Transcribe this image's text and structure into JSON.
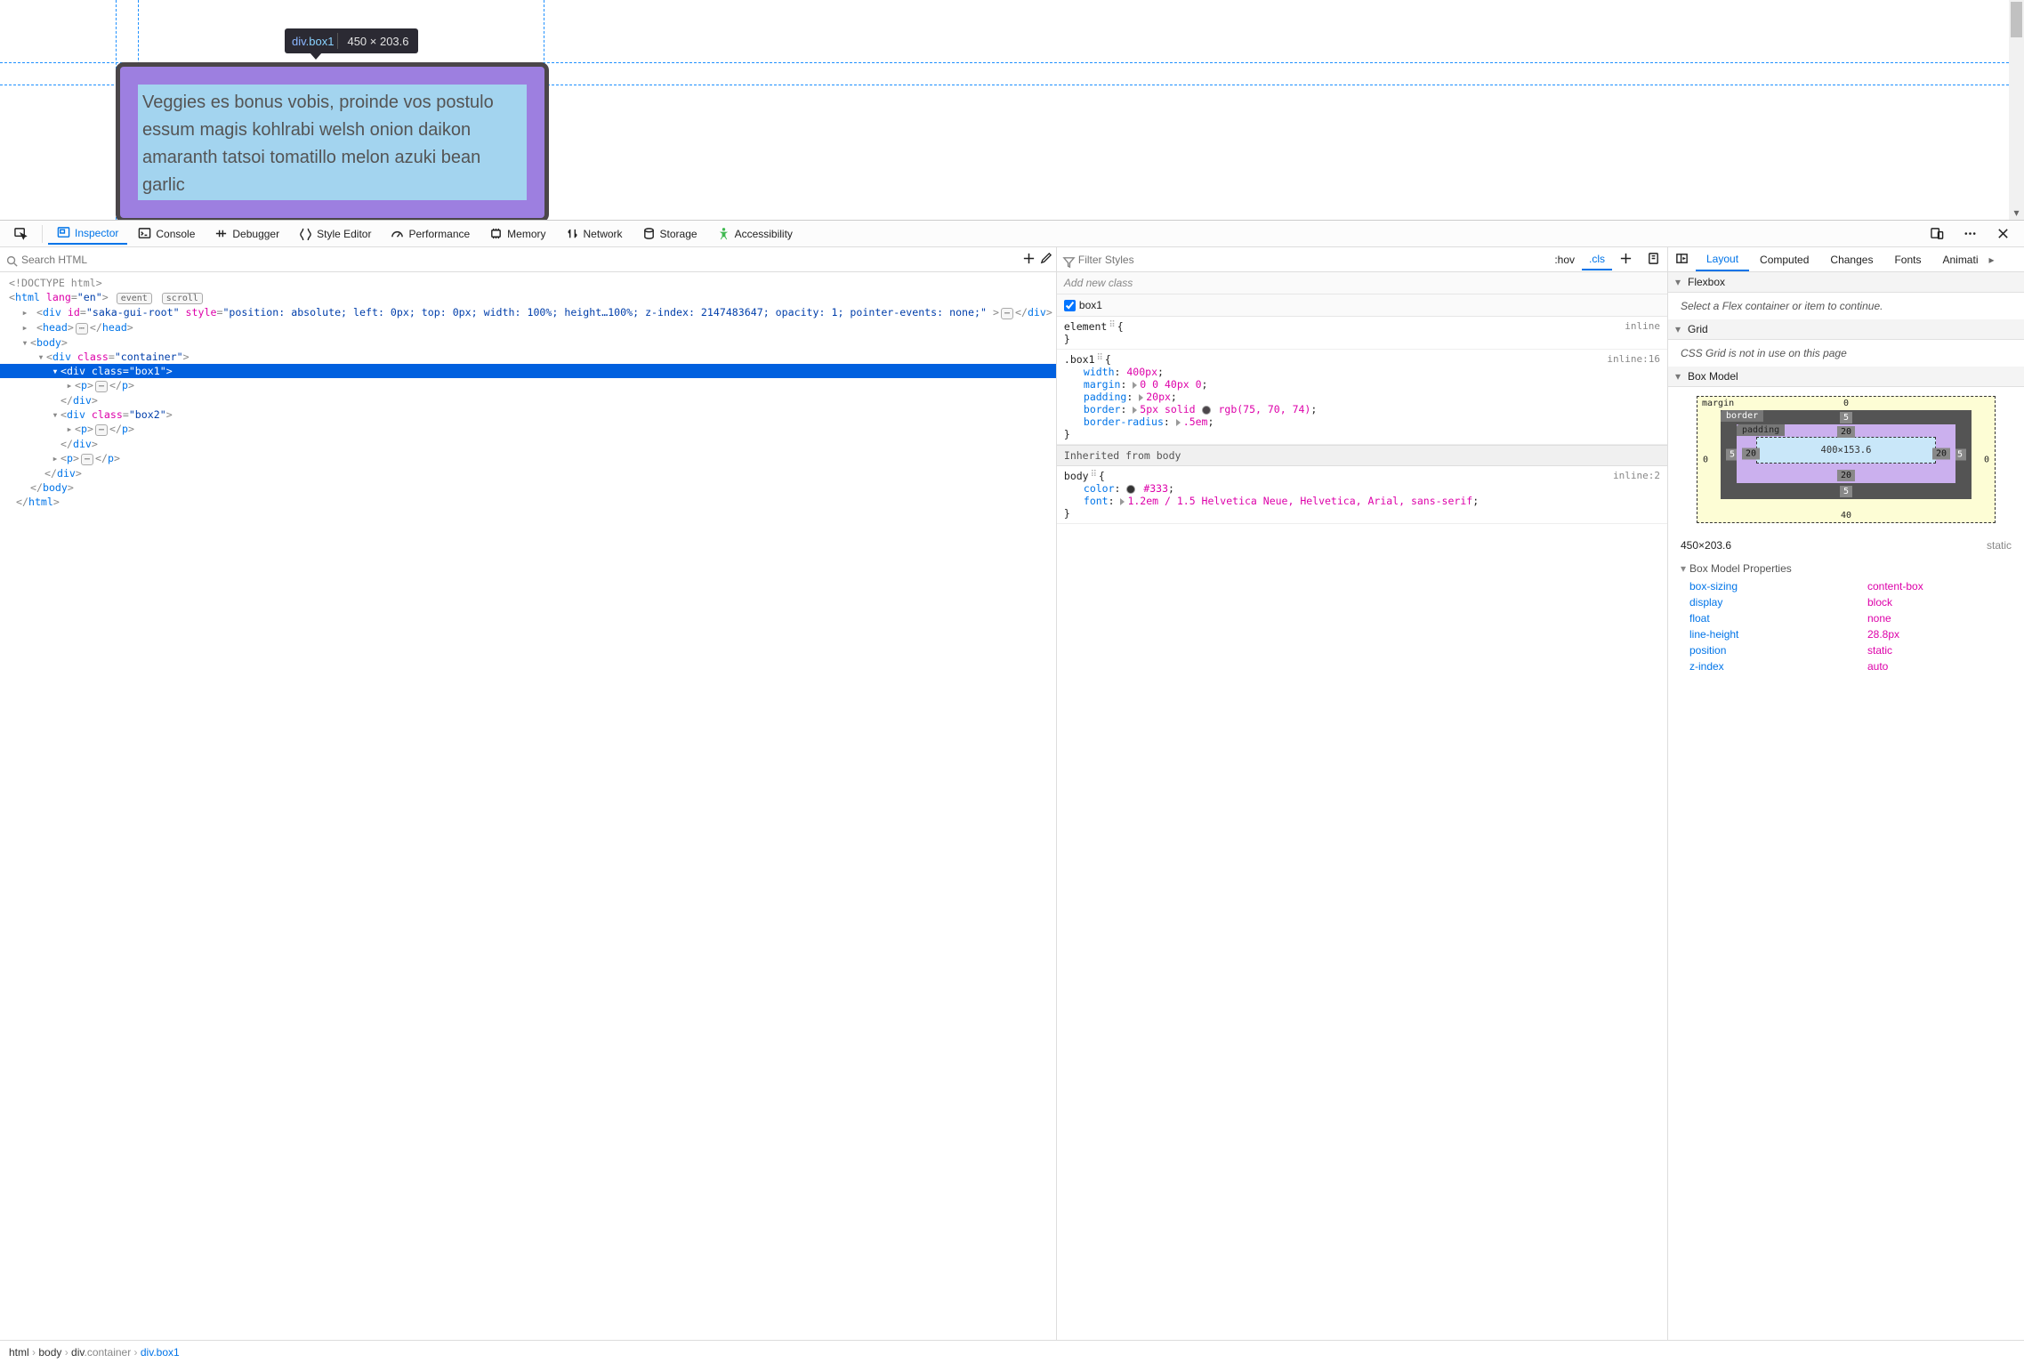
{
  "tooltip": {
    "tag": "div",
    "cls": ".box1",
    "dims": "450 × 203.6"
  },
  "viewport_text": "Veggies es bonus vobis, proinde vos postulo essum magis kohlrabi welsh onion daikon amaranth tatsoi tomatillo melon azuki bean garlic",
  "toolbar": {
    "inspector": "Inspector",
    "console": "Console",
    "debugger": "Debugger",
    "styleeditor": "Style Editor",
    "performance": "Performance",
    "memory": "Memory",
    "network": "Network",
    "storage": "Storage",
    "accessibility": "Accessibility"
  },
  "dom_search_placeholder": "Search HTML",
  "dom": {
    "doctype": "<!DOCTYPE html>",
    "html_open": "html",
    "html_lang_attr": "lang",
    "html_lang_val": "\"en\"",
    "badge_event": "event",
    "badge_scroll": "scroll",
    "saka_div": {
      "id_attr": "id",
      "id_val": "\"saka-gui-root\"",
      "style_attr": "style",
      "style_val": "\"position: absolute; left: 0px; top: 0px; width: 100%; height…100%; z-index: 2147483647; opacity: 1; pointer-events: none;\""
    },
    "head": "head",
    "body": "body",
    "c_class": "class",
    "c_container": "\"container\"",
    "c_box1": "\"box1\"",
    "c_box2": "\"box2\"",
    "div": "div",
    "p": "p",
    "html_c": "html",
    "body_c": "body"
  },
  "rules": {
    "filter_placeholder": "Filter Styles",
    "hov": ":hov",
    "cls": ".cls",
    "addclass": "Add new class",
    "class_box1": "box1",
    "r_element": {
      "sel": "element",
      "src": "inline"
    },
    "r_box1": {
      "sel": ".box1",
      "src": "inline:16",
      "width": {
        "n": "width",
        "v": "400px"
      },
      "margin": {
        "n": "margin",
        "v": "0 0 40px 0"
      },
      "padding": {
        "n": "padding",
        "v": "20px"
      },
      "border": {
        "n": "border",
        "v1": "5px solid",
        "v2": "rgb(75, 70, 74)"
      },
      "radius": {
        "n": "border-radius",
        "v": ".5em"
      }
    },
    "inh_hdr": "Inherited from body",
    "r_body": {
      "sel": "body",
      "src": "inline:2",
      "color": {
        "n": "color",
        "v": "#333"
      },
      "font": {
        "n": "font",
        "v": "1.2em / 1.5 Helvetica Neue, Helvetica, Arial, sans-serif"
      }
    }
  },
  "sidebar": {
    "tabs": {
      "layout": "Layout",
      "computed": "Computed",
      "changes": "Changes",
      "fonts": "Fonts",
      "anim": "Animati"
    },
    "flexbox_hdr": "Flexbox",
    "flexbox_msg": "Select a Flex container or item to continue.",
    "grid_hdr": "Grid",
    "grid_msg": "CSS Grid is not in use on this page",
    "bm_hdr": "Box Model",
    "bm": {
      "margin": "margin",
      "border": "border",
      "padding": "padding",
      "m_top": "0",
      "m_right": "0",
      "m_bottom": "40",
      "m_left": "0",
      "b_top": "5",
      "b_right": "5",
      "b_bottom": "5",
      "b_left": "5",
      "p_top": "20",
      "p_right": "20",
      "p_bottom": "20",
      "p_left": "20",
      "content": "400×153.6"
    },
    "info_dims": "450×203.6",
    "info_pos": "static",
    "bmp_hdr": "Box Model Properties",
    "props": [
      {
        "k": "box-sizing",
        "v": "content-box"
      },
      {
        "k": "display",
        "v": "block"
      },
      {
        "k": "float",
        "v": "none"
      },
      {
        "k": "line-height",
        "v": "28.8px"
      },
      {
        "k": "position",
        "v": "static"
      },
      {
        "k": "z-index",
        "v": "auto"
      }
    ]
  },
  "crumbs": [
    {
      "t": "html",
      "c": ""
    },
    {
      "t": "body",
      "c": ""
    },
    {
      "t": "div",
      "c": ".container"
    },
    {
      "t": "div",
      "c": ".box1"
    }
  ]
}
